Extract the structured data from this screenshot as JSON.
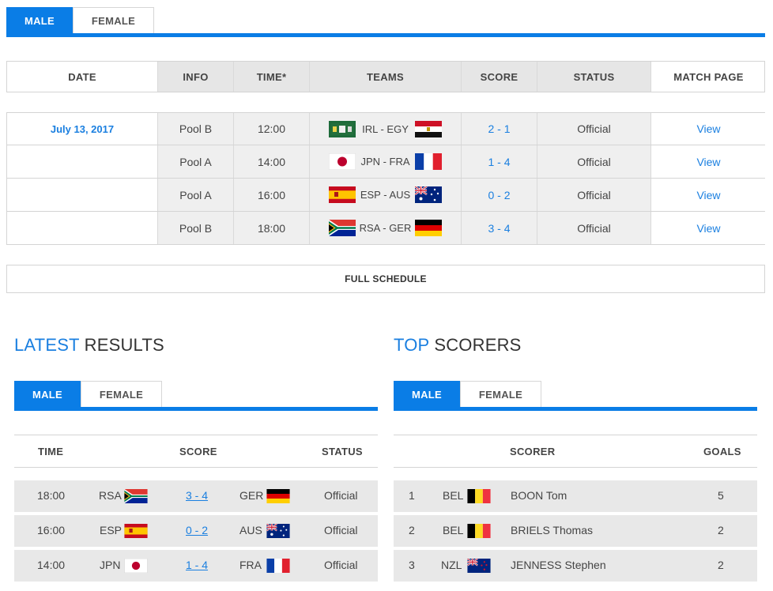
{
  "top_tabs": {
    "male": "MALE",
    "female": "FEMALE"
  },
  "schedule": {
    "headers": [
      "DATE",
      "INFO",
      "TIME*",
      "TEAMS",
      "SCORE",
      "STATUS",
      "MATCH PAGE"
    ],
    "date": "July 13, 2017",
    "rows": [
      {
        "info": "Pool B",
        "time": "12:00",
        "teams": "IRL - EGY",
        "home_flag": "ireland-flag-icon",
        "away_flag": "egypt-flag-icon",
        "score": "2 - 1",
        "status": "Official",
        "link": "View"
      },
      {
        "info": "Pool A",
        "time": "14:00",
        "teams": "JPN - FRA",
        "home_flag": "japan-flag-icon",
        "away_flag": "france-flag-icon",
        "score": "1 - 4",
        "status": "Official",
        "link": "View"
      },
      {
        "info": "Pool A",
        "time": "16:00",
        "teams": "ESP - AUS",
        "home_flag": "spain-flag-icon",
        "away_flag": "australia-flag-icon",
        "score": "0 - 2",
        "status": "Official",
        "link": "View"
      },
      {
        "info": "Pool B",
        "time": "18:00",
        "teams": "RSA - GER",
        "home_flag": "south-africa-flag-icon",
        "away_flag": "germany-flag-icon",
        "score": "3 - 4",
        "status": "Official",
        "link": "View"
      }
    ],
    "full_schedule": "FULL SCHEDULE"
  },
  "latest_results": {
    "title_accent": "LATEST",
    "title_rest": " RESULTS",
    "tabs": {
      "male": "MALE",
      "female": "FEMALE"
    },
    "headers": {
      "time": "TIME",
      "score": "SCORE",
      "status": "STATUS"
    },
    "rows": [
      {
        "time": "18:00",
        "home": "RSA",
        "score": "3 - 4",
        "away": "GER",
        "status": "Official"
      },
      {
        "time": "16:00",
        "home": "ESP",
        "score": "0 - 2",
        "away": "AUS",
        "status": "Official"
      },
      {
        "time": "14:00",
        "home": "JPN",
        "score": "1 - 4",
        "away": "FRA",
        "status": "Official"
      }
    ]
  },
  "top_scorers": {
    "title_accent": "TOP",
    "title_rest": " SCORERS",
    "tabs": {
      "male": "MALE",
      "female": "FEMALE"
    },
    "headers": {
      "scorer": "SCORER",
      "goals": "GOALS"
    },
    "rows": [
      {
        "rank": "1",
        "country": "BEL",
        "name": "BOON Tom",
        "goals": "5"
      },
      {
        "rank": "2",
        "country": "BEL",
        "name": "BRIELS Thomas",
        "goals": "2"
      },
      {
        "rank": "3",
        "country": "NZL",
        "name": "JENNESS Stephen",
        "goals": "2"
      }
    ]
  },
  "colors": {
    "accent": "#0a7de6",
    "link": "#1a7fe0"
  }
}
